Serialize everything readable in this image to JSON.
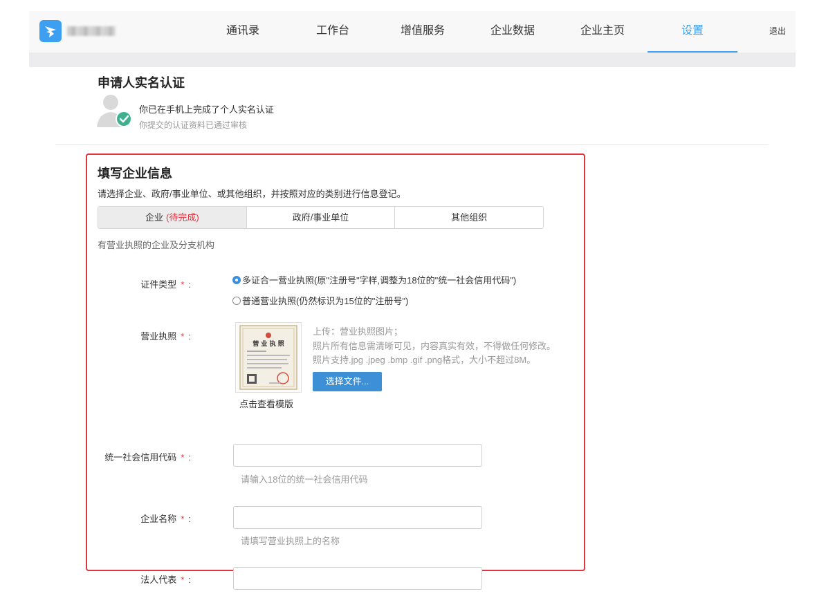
{
  "header": {
    "nav": [
      {
        "label": "通讯录",
        "active": false
      },
      {
        "label": "工作台",
        "active": false
      },
      {
        "label": "增值服务",
        "active": false
      },
      {
        "label": "企业数据",
        "active": false
      },
      {
        "label": "企业主页",
        "active": false
      },
      {
        "label": "设置",
        "active": true
      }
    ],
    "logout": "退出",
    "accent_color": "#3d9ff2"
  },
  "applicant": {
    "title": "申请人实名认证",
    "line1": "你已在手机上完成了个人实名认证",
    "line2": "你提交的认证资料已通过审核"
  },
  "enterprise": {
    "title": "填写企业信息",
    "description": "请选择企业、政府/事业单位、或其他组织，并按照对应的类别进行信息登记。",
    "tabs": [
      {
        "label": "企业",
        "badge": "(待完成)",
        "active": true
      },
      {
        "label": "政府/事业单位",
        "active": false
      },
      {
        "label": "其他组织",
        "active": false
      }
    ],
    "tab_description": "有营业执照的企业及分支机构",
    "cert_type": {
      "label": "证件类型",
      "options": [
        {
          "label": "多证合一营业执照(原\"注册号\"字样,调整为18位的\"统一社会信用代码\")",
          "checked": true
        },
        {
          "label": "普通营业执照(仍然标识为15位的\"注册号\")",
          "checked": false
        }
      ]
    },
    "license": {
      "label": "营业执照",
      "template_link": "点击查看模版",
      "thumb_title": "营 业 执 照",
      "upload_lines": [
        "上传：营业执照图片；",
        "照片所有信息需清晰可见，内容真实有效，不得做任何修改。",
        "照片支持.jpg .jpeg .bmp .gif .png格式，大小不超过8M。"
      ],
      "choose_button": "选择文件..."
    },
    "credit_code": {
      "label": "统一社会信用代码",
      "value": "",
      "hint": "请输入18位的统一社会信用代码"
    },
    "company_name": {
      "label": "企业名称",
      "value": "",
      "hint": "请填写营业执照上的名称"
    },
    "legal_rep": {
      "label": "法人代表",
      "value": ""
    },
    "required_mark": "*",
    "colon": ":"
  }
}
